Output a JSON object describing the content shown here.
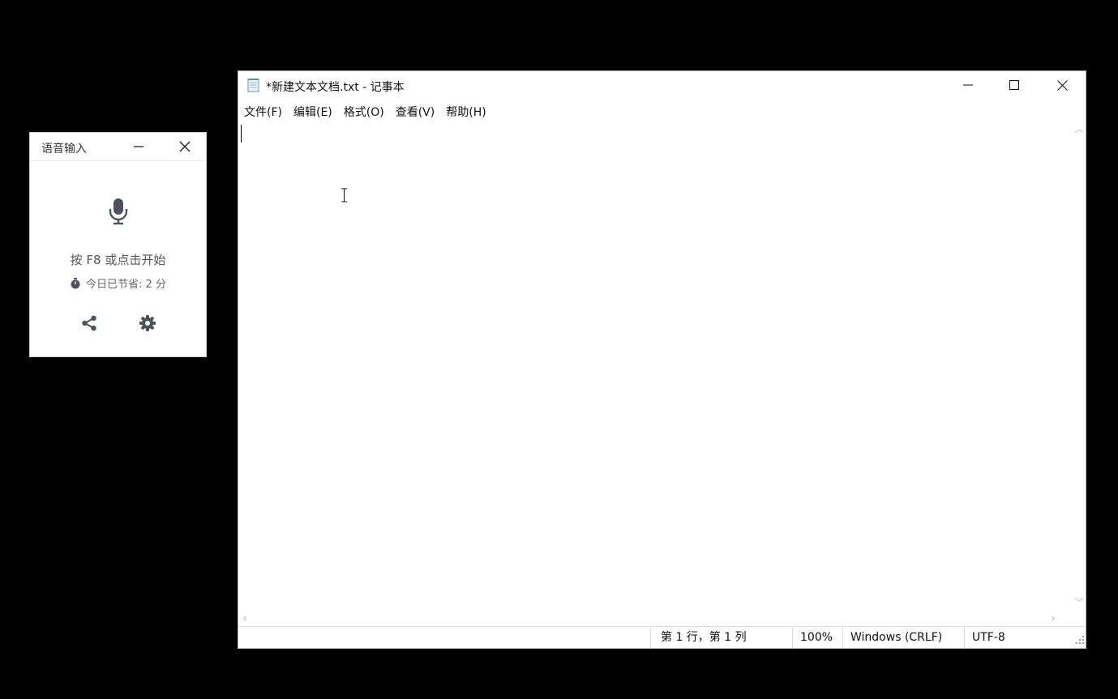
{
  "voice_input": {
    "title": "语音输入",
    "hint": "按 F8 或点击开始",
    "saved_today": "今日已节省: 2 分",
    "icons": [
      "microphone-icon",
      "timer-icon",
      "share-icon",
      "gear-icon",
      "minimize-icon",
      "close-icon"
    ],
    "icon_color": "#4a5260"
  },
  "notepad": {
    "title": "*新建文本文档.txt - 记事本",
    "menu": [
      "文件(F)",
      "编辑(E)",
      "格式(O)",
      "查看(V)",
      "帮助(H)"
    ],
    "content": "",
    "status": {
      "position": "第 1 行，第 1 列",
      "zoom": "100%",
      "line_ending": "Windows (CRLF)",
      "encoding": "UTF-8"
    }
  }
}
